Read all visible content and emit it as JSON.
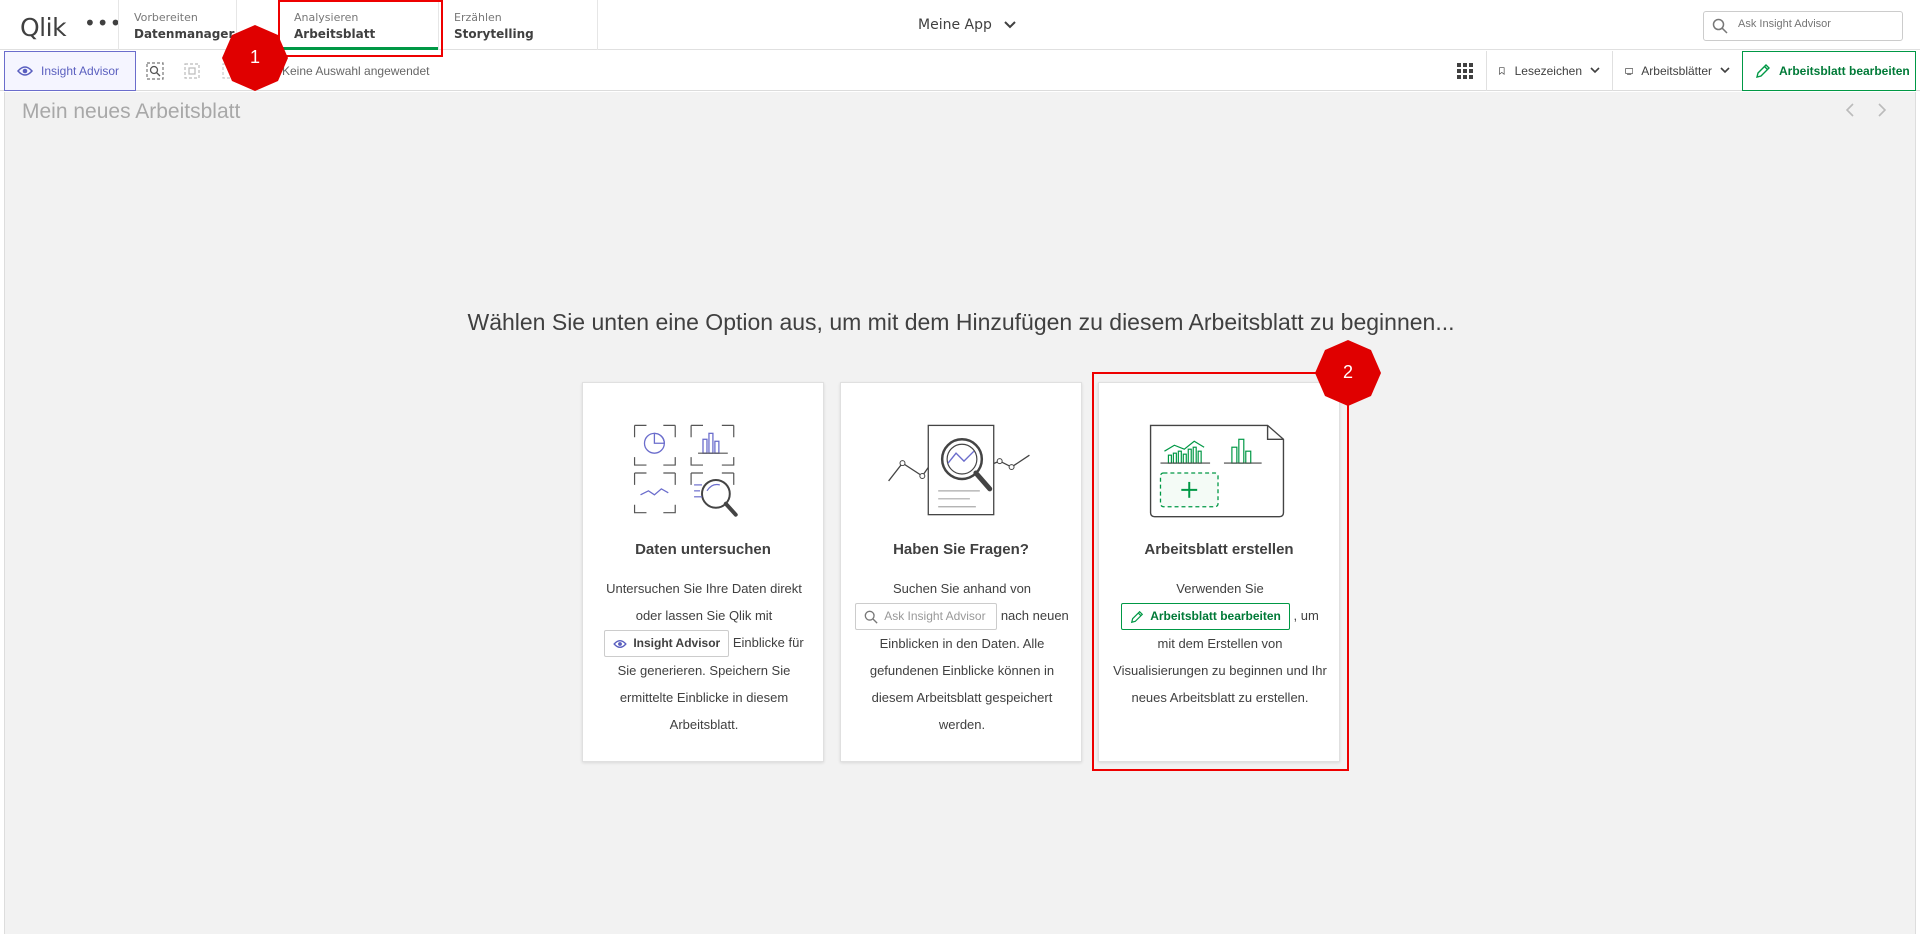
{
  "logo": "Qlik",
  "nav": {
    "tabs": [
      {
        "small": "Vorbereiten",
        "big": "Datenmanager"
      },
      {
        "small": "Analysieren",
        "big": "Arbeitsblatt"
      },
      {
        "small": "Erzählen",
        "big": "Storytelling"
      }
    ],
    "app_name": "Meine App",
    "search_placeholder": "Ask Insight Advisor"
  },
  "toolbar": {
    "insight_advisor": "Insight Advisor",
    "no_selection": "Keine Auswahl angewendet",
    "bookmarks": "Lesezeichen",
    "sheets": "Arbeitsblätter",
    "edit_sheet": "Arbeitsblatt bearbeiten"
  },
  "sheet": {
    "title": "Mein neues Arbeitsblatt",
    "prompt": "Wählen Sie unten eine Option aus, um mit dem Hinzufügen zu diesem Arbeitsblatt zu beginnen...",
    "cards": [
      {
        "title": "Daten untersuchen",
        "text_before": "Untersuchen Sie Ihre Daten direkt oder lassen Sie Qlik mit",
        "button": "Insight Advisor",
        "text_after": "Einblicke für Sie generieren. Speichern Sie ermittelte Einblicke in diesem Arbeitsblatt."
      },
      {
        "title": "Haben Sie Fragen?",
        "text_before": "Suchen Sie anhand von",
        "button": "Ask Insight Advisor",
        "text_after": "nach neuen Einblicken in den Daten. Alle gefundenen Einblicke können in diesem Arbeitsblatt gespeichert werden."
      },
      {
        "title": "Arbeitsblatt erstellen",
        "text_before": "Verwenden Sie",
        "button": "Arbeitsblatt bearbeiten",
        "text_after": ", um mit dem Erstellen von Visualisierungen zu beginnen und Ihr neues Arbeitsblatt zu erstellen."
      }
    ]
  },
  "annotations": {
    "badge1": "1",
    "badge2": "2"
  },
  "colors": {
    "accent_green": "#009845",
    "insight_purple": "#6b6dcc",
    "annotation_red": "#e00000"
  }
}
